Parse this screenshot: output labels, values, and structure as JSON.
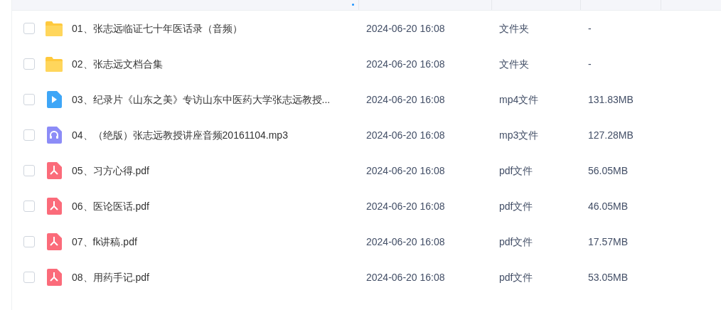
{
  "files": [
    {
      "kind": "folder",
      "checked": false,
      "name": "01、张志远临证七十年医话录（音频）",
      "modified": "2024-06-20 16:08",
      "type": "文件夹",
      "size": "-"
    },
    {
      "kind": "folder",
      "checked": false,
      "name": "02、张志远文档合集",
      "modified": "2024-06-20 16:08",
      "type": "文件夹",
      "size": "-"
    },
    {
      "kind": "video",
      "checked": false,
      "name": "03、纪录片《山东之美》专访山东中医药大学张志远教授...",
      "modified": "2024-06-20 16:08",
      "type": "mp4文件",
      "size": "131.83MB"
    },
    {
      "kind": "audio",
      "checked": false,
      "name": "04、（绝版）张志远教授讲座音频20161104.mp3",
      "modified": "2024-06-20 16:08",
      "type": "mp3文件",
      "size": "127.28MB"
    },
    {
      "kind": "pdf",
      "checked": false,
      "name": "05、习方心得.pdf",
      "modified": "2024-06-20 16:08",
      "type": "pdf文件",
      "size": "56.05MB"
    },
    {
      "kind": "pdf",
      "checked": false,
      "name": "06、医论医话.pdf",
      "modified": "2024-06-20 16:08",
      "type": "pdf文件",
      "size": "46.05MB"
    },
    {
      "kind": "pdf",
      "checked": false,
      "name": "07、fk讲稿.pdf",
      "modified": "2024-06-20 16:08",
      "type": "pdf文件",
      "size": "17.57MB"
    },
    {
      "kind": "pdf",
      "checked": false,
      "name": "08、用药手记.pdf",
      "modified": "2024-06-20 16:08",
      "type": "pdf文件",
      "size": "53.05MB"
    }
  ]
}
